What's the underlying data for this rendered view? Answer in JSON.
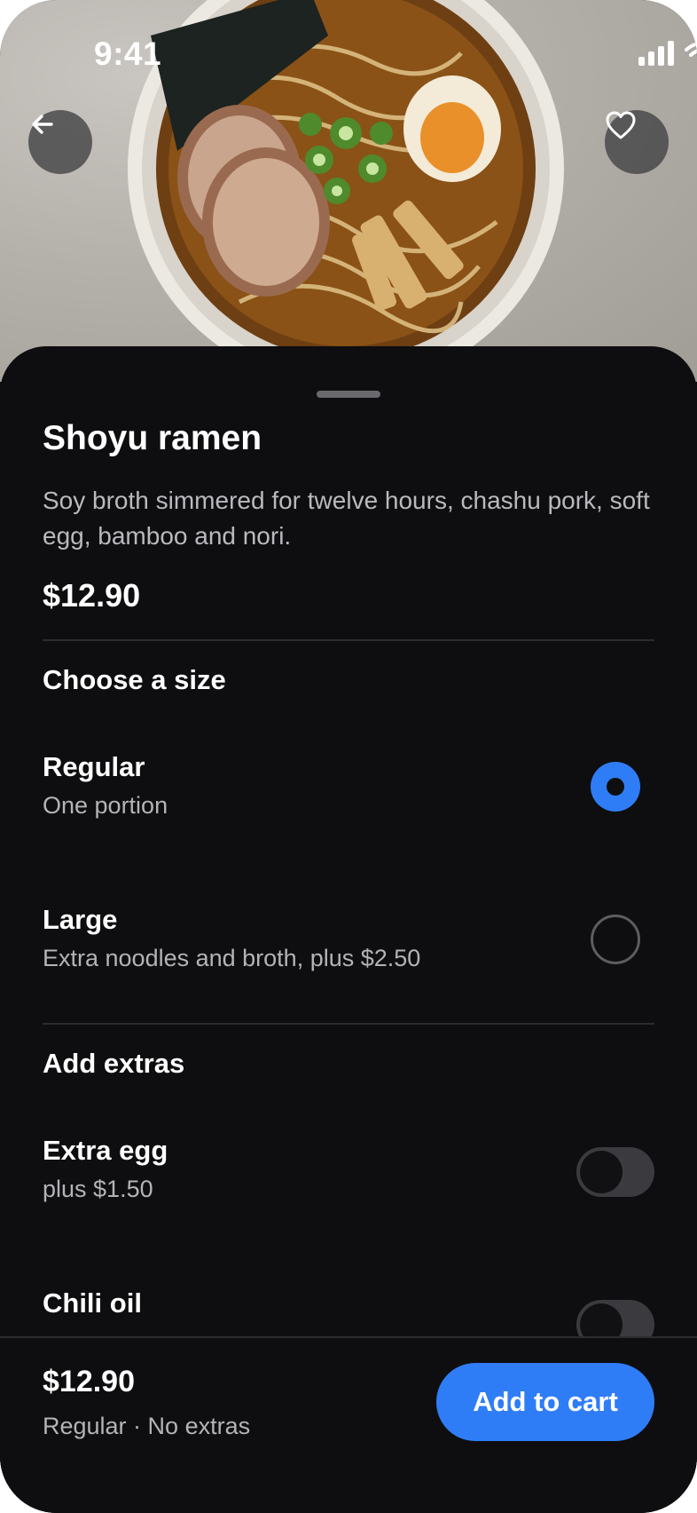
{
  "status_bar": {
    "time": "9:41"
  },
  "item": {
    "title": "Shoyu ramen",
    "description": "Soy broth simmered for twelve hours, chashu pork, soft egg, bamboo and nori.",
    "price": "$12.90"
  },
  "size_section": {
    "title": "Choose a size",
    "options": [
      {
        "name": "Regular",
        "detail": "One portion",
        "selected": true
      },
      {
        "name": "Large",
        "detail": "Extra noodles and broth, plus $2.50",
        "selected": false
      }
    ]
  },
  "extras_section": {
    "title": "Add extras",
    "options": [
      {
        "name": "Extra egg",
        "detail": "plus $1.50",
        "enabled": false
      },
      {
        "name": "Chili oil",
        "enabled": false
      }
    ]
  },
  "footer": {
    "total": "$12.90",
    "summary": "Regular · No extras",
    "cta_label": "Add to cart"
  },
  "icons": {
    "back": "arrow-left-icon",
    "favorite": "heart-icon",
    "signal": "signal-icon",
    "wifi": "wifi-icon",
    "battery": "battery-icon"
  },
  "colors": {
    "accent": "#2f7df6",
    "sheet_background": "#0e0e10",
    "primary_text": "#ffffff",
    "secondary_text": "#b3b3b8"
  }
}
